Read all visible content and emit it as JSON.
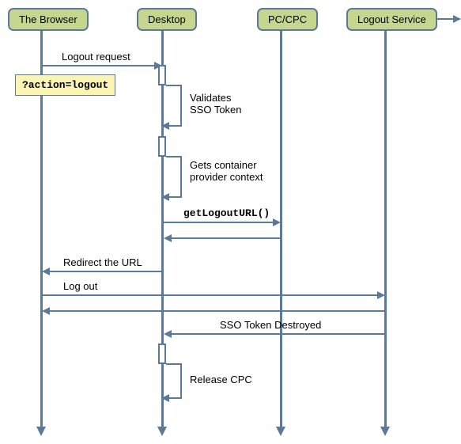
{
  "participants": {
    "browser": "The Browser",
    "desktop": "Desktop",
    "pcCpc": "PC/CPC",
    "logoutService": "Logout Service"
  },
  "note": "?action=logout",
  "messages": {
    "logoutRequest": "Logout request",
    "validatesSso": "Validates\nSSO Token",
    "getsContainer": "Gets container\nprovider context",
    "getLogoutUrl": "getLogoutURL()",
    "redirectUrl": "Redirect the URL",
    "logOut": "Log out",
    "ssoDestroyed": "SSO Token Destroyed",
    "releaseCpc": "Release CPC"
  },
  "layout": {
    "lanes": {
      "browser": 52,
      "desktop": 205,
      "pcCpc": 355,
      "logoutService": 487
    }
  }
}
